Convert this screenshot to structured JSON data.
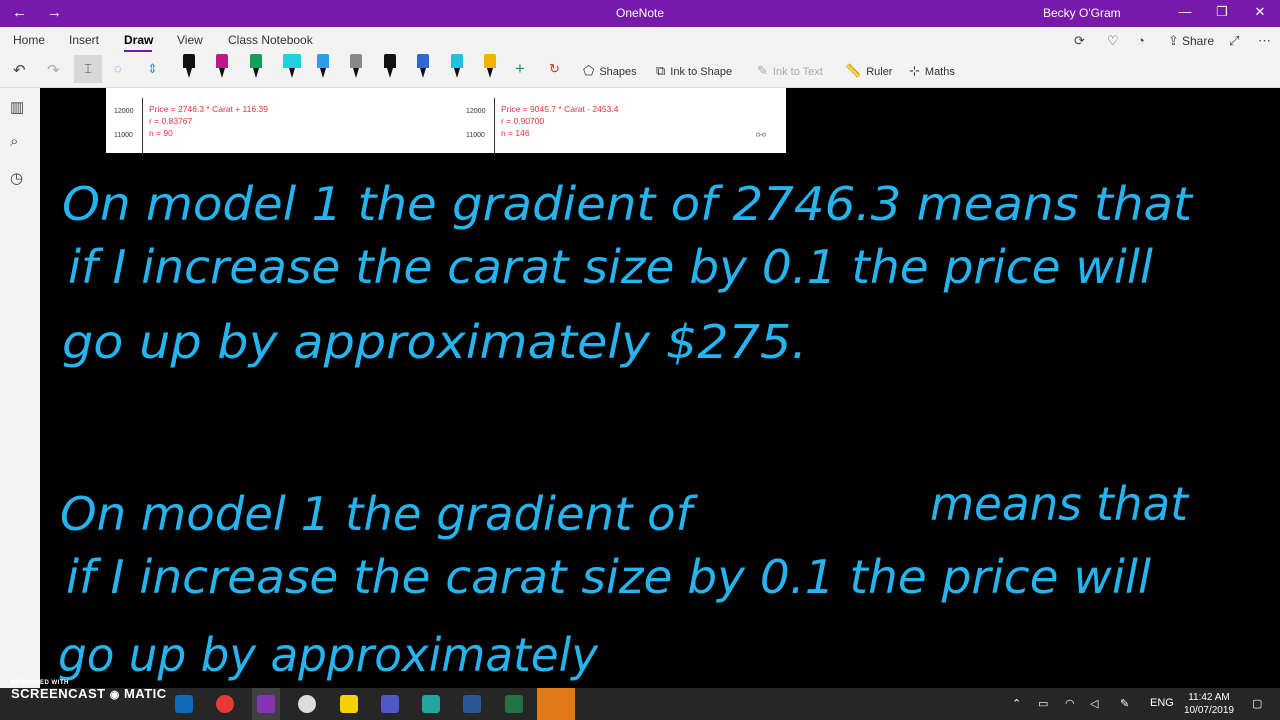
{
  "window": {
    "title": "OneNote",
    "user": "Becky O'Gram",
    "back_glyph": "←",
    "forward_glyph": "→",
    "minimize_glyph": "—",
    "restore_glyph": "❐",
    "close_glyph": "✕",
    "accent": "#7719aa"
  },
  "ribbon": {
    "tabs": [
      "Home",
      "Insert",
      "Draw",
      "View",
      "Class Notebook"
    ],
    "active_tab": "Draw",
    "share_label": "Share",
    "tools": {
      "shapes": "Shapes",
      "ink_to_shape": "Ink to Shape",
      "ink_to_text": "Ink to Text",
      "ruler": "Ruler",
      "maths": "Maths"
    },
    "pen_colors": [
      "#111111",
      "#c2188a",
      "#13a05a",
      "#20d0e0",
      "#2aa0e0",
      "#888888",
      "#111111",
      "#2a6ad0",
      "#20c0e0",
      "#f0b400"
    ],
    "highlighter_color": "#f7e06e"
  },
  "embedded_image": {
    "left": {
      "ticks": [
        "12000",
        "11000"
      ],
      "lines": [
        "Price = 2746.3 * Carat + 116.39",
        "r = 0.83767",
        "n = 90"
      ]
    },
    "right": {
      "ticks": [
        "12000",
        "11000"
      ],
      "lines": [
        "Price = 9045.7 * Carat - 2453.4",
        "r = 0.90700",
        "n = 146"
      ]
    }
  },
  "ink": {
    "color": "#25b4ee",
    "paragraph1": [
      "On model 1 the gradient of 2746.3 means that",
      "if I increase the carat size by 0.1 the price will",
      "go up by approximately $275."
    ],
    "paragraph2_a": "On model 1 the gradient of",
    "paragraph2_b": "means that",
    "paragraph2_lines": [
      "if I increase the carat size by 0.1 the price will",
      "go up by approximately"
    ]
  },
  "taskbar": {
    "time": "11:42 AM",
    "date": "10/07/2019",
    "language": "ENG",
    "watermark_top": "RECORDED WITH",
    "watermark_brand": "SCREENCAST",
    "watermark_suffix": "MATIC"
  }
}
